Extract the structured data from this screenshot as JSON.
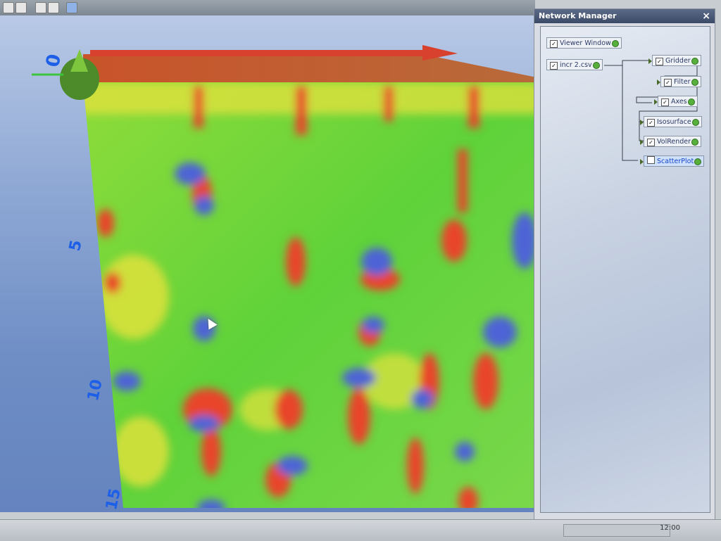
{
  "panel": {
    "title": "Network Manager",
    "close_glyph": "×",
    "modules": [
      {
        "label": "Viewer Window",
        "checked": true
      },
      {
        "label": "incr 2.csv",
        "checked": true
      },
      {
        "label": "Gridder",
        "checked": true
      },
      {
        "label": "Filter",
        "checked": true
      },
      {
        "label": "Axes",
        "checked": true
      },
      {
        "label": "Isosurface",
        "checked": true
      },
      {
        "label": "VolRender",
        "checked": true
      },
      {
        "label": "ScatterPlot",
        "checked": false,
        "selected": true
      }
    ]
  },
  "viewport": {
    "axis_ticks": [
      "0",
      "5",
      "10",
      "15"
    ],
    "colors": {
      "background_top": "#b9c9e6",
      "background_bottom": "#6584bf",
      "volume_green": "#5fd23a",
      "volume_yellow": "#e6e23c",
      "volume_red": "#e8452a",
      "volume_blue": "#4d63d6",
      "axis_arrow": "#d9412f",
      "tick_label": "#1e5fe8"
    },
    "icons": [
      "axis-arrow-icon",
      "origin-cone-icon",
      "mouse-cursor-icon"
    ]
  },
  "taskbar": {
    "clock": "12:00"
  }
}
